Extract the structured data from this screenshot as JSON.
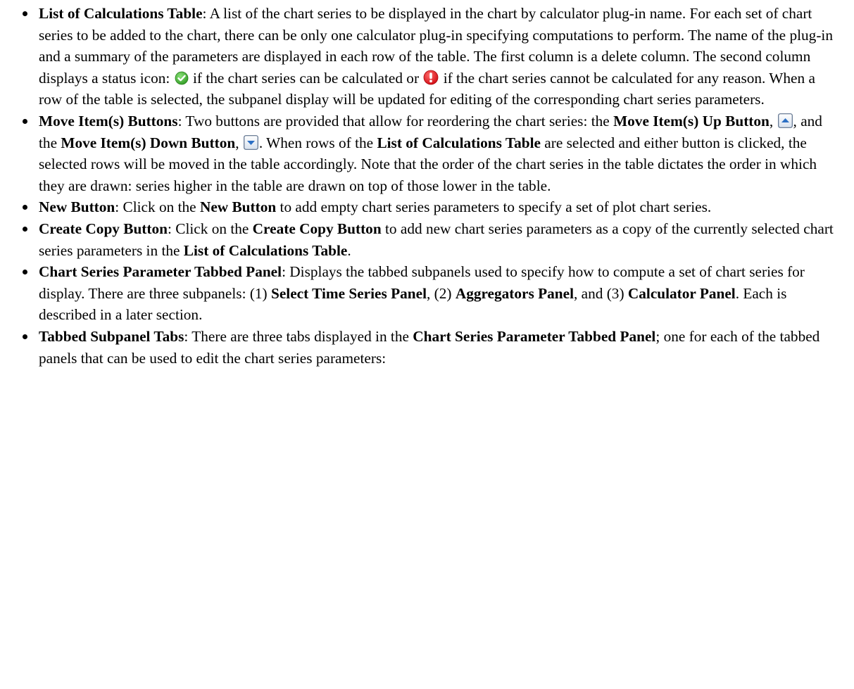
{
  "items": [
    {
      "term": "List of Calculations Table",
      "p1": ": A list of the chart series to be displayed in the chart by calculator plug-in name. For each set of chart series to be added to the chart, there can be only one calculator plug-in specifying computations to perform. The name of the plug-in and a summary of the parameters are displayed in each row of the table. The first column is a delete column. The second column displays a status icon: ",
      "p2": " if the chart series can be calculated or ",
      "p3": " if the chart series cannot be calculated for any reason. When a row of the table is selected, the subpanel display will be updated for editing of the corresponding chart series parameters."
    },
    {
      "term": "Move Item(s) Buttons",
      "p1": ": Two buttons are provided that allow for reordering the chart series: the ",
      "b1": "Move Item(s) Up Button",
      "p2": ", ",
      "p3": ", and the ",
      "b2": "Move Item(s) Down Button",
      "p4": ", ",
      "p5": ". When rows of the ",
      "b3": "List of Calculations Table",
      "p6": " are selected and either button is clicked, the selected rows will be moved in the table accordingly. Note that the order of the chart series in the table dictates the order in which they are drawn: series higher in the table are drawn on top of those lower in the table."
    },
    {
      "term": "New Button",
      "p1": ": Click on the ",
      "b1": "New Button",
      "p2": " to add empty chart series parameters to specify a set of plot chart series."
    },
    {
      "term": "Create Copy Button",
      "p1": ": Click on the ",
      "b1": "Create Copy Button",
      "p2": " to add new chart series parameters as a copy of the currently selected chart series parameters in the ",
      "b2": "List of Calculations Table",
      "p3": "."
    },
    {
      "term": "Chart Series Parameter Tabbed Panel",
      "p1": ": Displays the tabbed subpanels used to specify how to compute a set of chart series for display. There are three subpanels: (1) ",
      "b1": "Select Time Series Panel",
      "p2": ", (2) ",
      "b2": "Aggregators Panel",
      "p3": ", and (3) ",
      "b3": "Calculator Panel",
      "p4": ". Each is described in a later section."
    },
    {
      "term": "Tabbed Subpanel Tabs",
      "p1": ": There are three tabs displayed in the ",
      "b1": "Chart Series Parameter Tabbed Panel",
      "p2": "; one for each of the tabbed panels that can be used to edit the chart series parameters:"
    }
  ],
  "icons": {
    "ok": "check-circle-green",
    "error": "exclamation-circle-red",
    "up": "arrow-up-button",
    "down": "arrow-down-button"
  },
  "colors": {
    "ok": "#3cb02c",
    "error": "#e2131b",
    "button_border": "#5a6e8a",
    "button_arrow": "#2c6fc4"
  }
}
